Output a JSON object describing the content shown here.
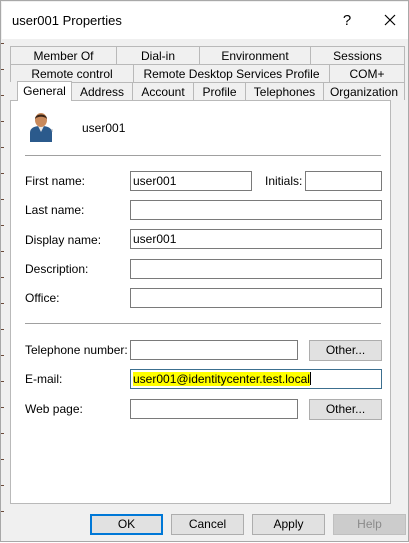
{
  "window": {
    "title": "user001 Properties",
    "help_glyph": "?"
  },
  "tabs": {
    "row1": [
      {
        "label": "Member Of"
      },
      {
        "label": "Dial-in"
      },
      {
        "label": "Environment"
      },
      {
        "label": "Sessions"
      }
    ],
    "row2": [
      {
        "label": "Remote control"
      },
      {
        "label": "Remote Desktop Services Profile"
      },
      {
        "label": "COM+"
      }
    ],
    "row3": [
      {
        "label": "General"
      },
      {
        "label": "Address"
      },
      {
        "label": "Account"
      },
      {
        "label": "Profile"
      },
      {
        "label": "Telephones"
      },
      {
        "label": "Organization"
      }
    ],
    "active": "General"
  },
  "general": {
    "display_username": "user001",
    "first_name": {
      "label": "First name:",
      "value": "user001"
    },
    "initials": {
      "label": "Initials:",
      "value": ""
    },
    "last_name": {
      "label": "Last name:",
      "value": ""
    },
    "display_name": {
      "label": "Display name:",
      "value": "user001"
    },
    "description": {
      "label": "Description:",
      "value": ""
    },
    "office": {
      "label": "Office:",
      "value": ""
    },
    "telephone": {
      "label": "Telephone number:",
      "value": "",
      "other_label": "Other..."
    },
    "email": {
      "label": "E-mail:",
      "value": "user001@identitycenter.test.local"
    },
    "web_page": {
      "label": "Web page:",
      "value": "",
      "other_label": "Other..."
    }
  },
  "footer": {
    "ok": "OK",
    "cancel": "Cancel",
    "apply": "Apply",
    "help": "Help"
  },
  "colors": {
    "highlight": "#ffff00",
    "focus_border": "#3c6f8f",
    "default_button_border": "#0078d7"
  },
  "icons": {
    "avatar": "user-avatar-icon",
    "close": "close-icon"
  }
}
